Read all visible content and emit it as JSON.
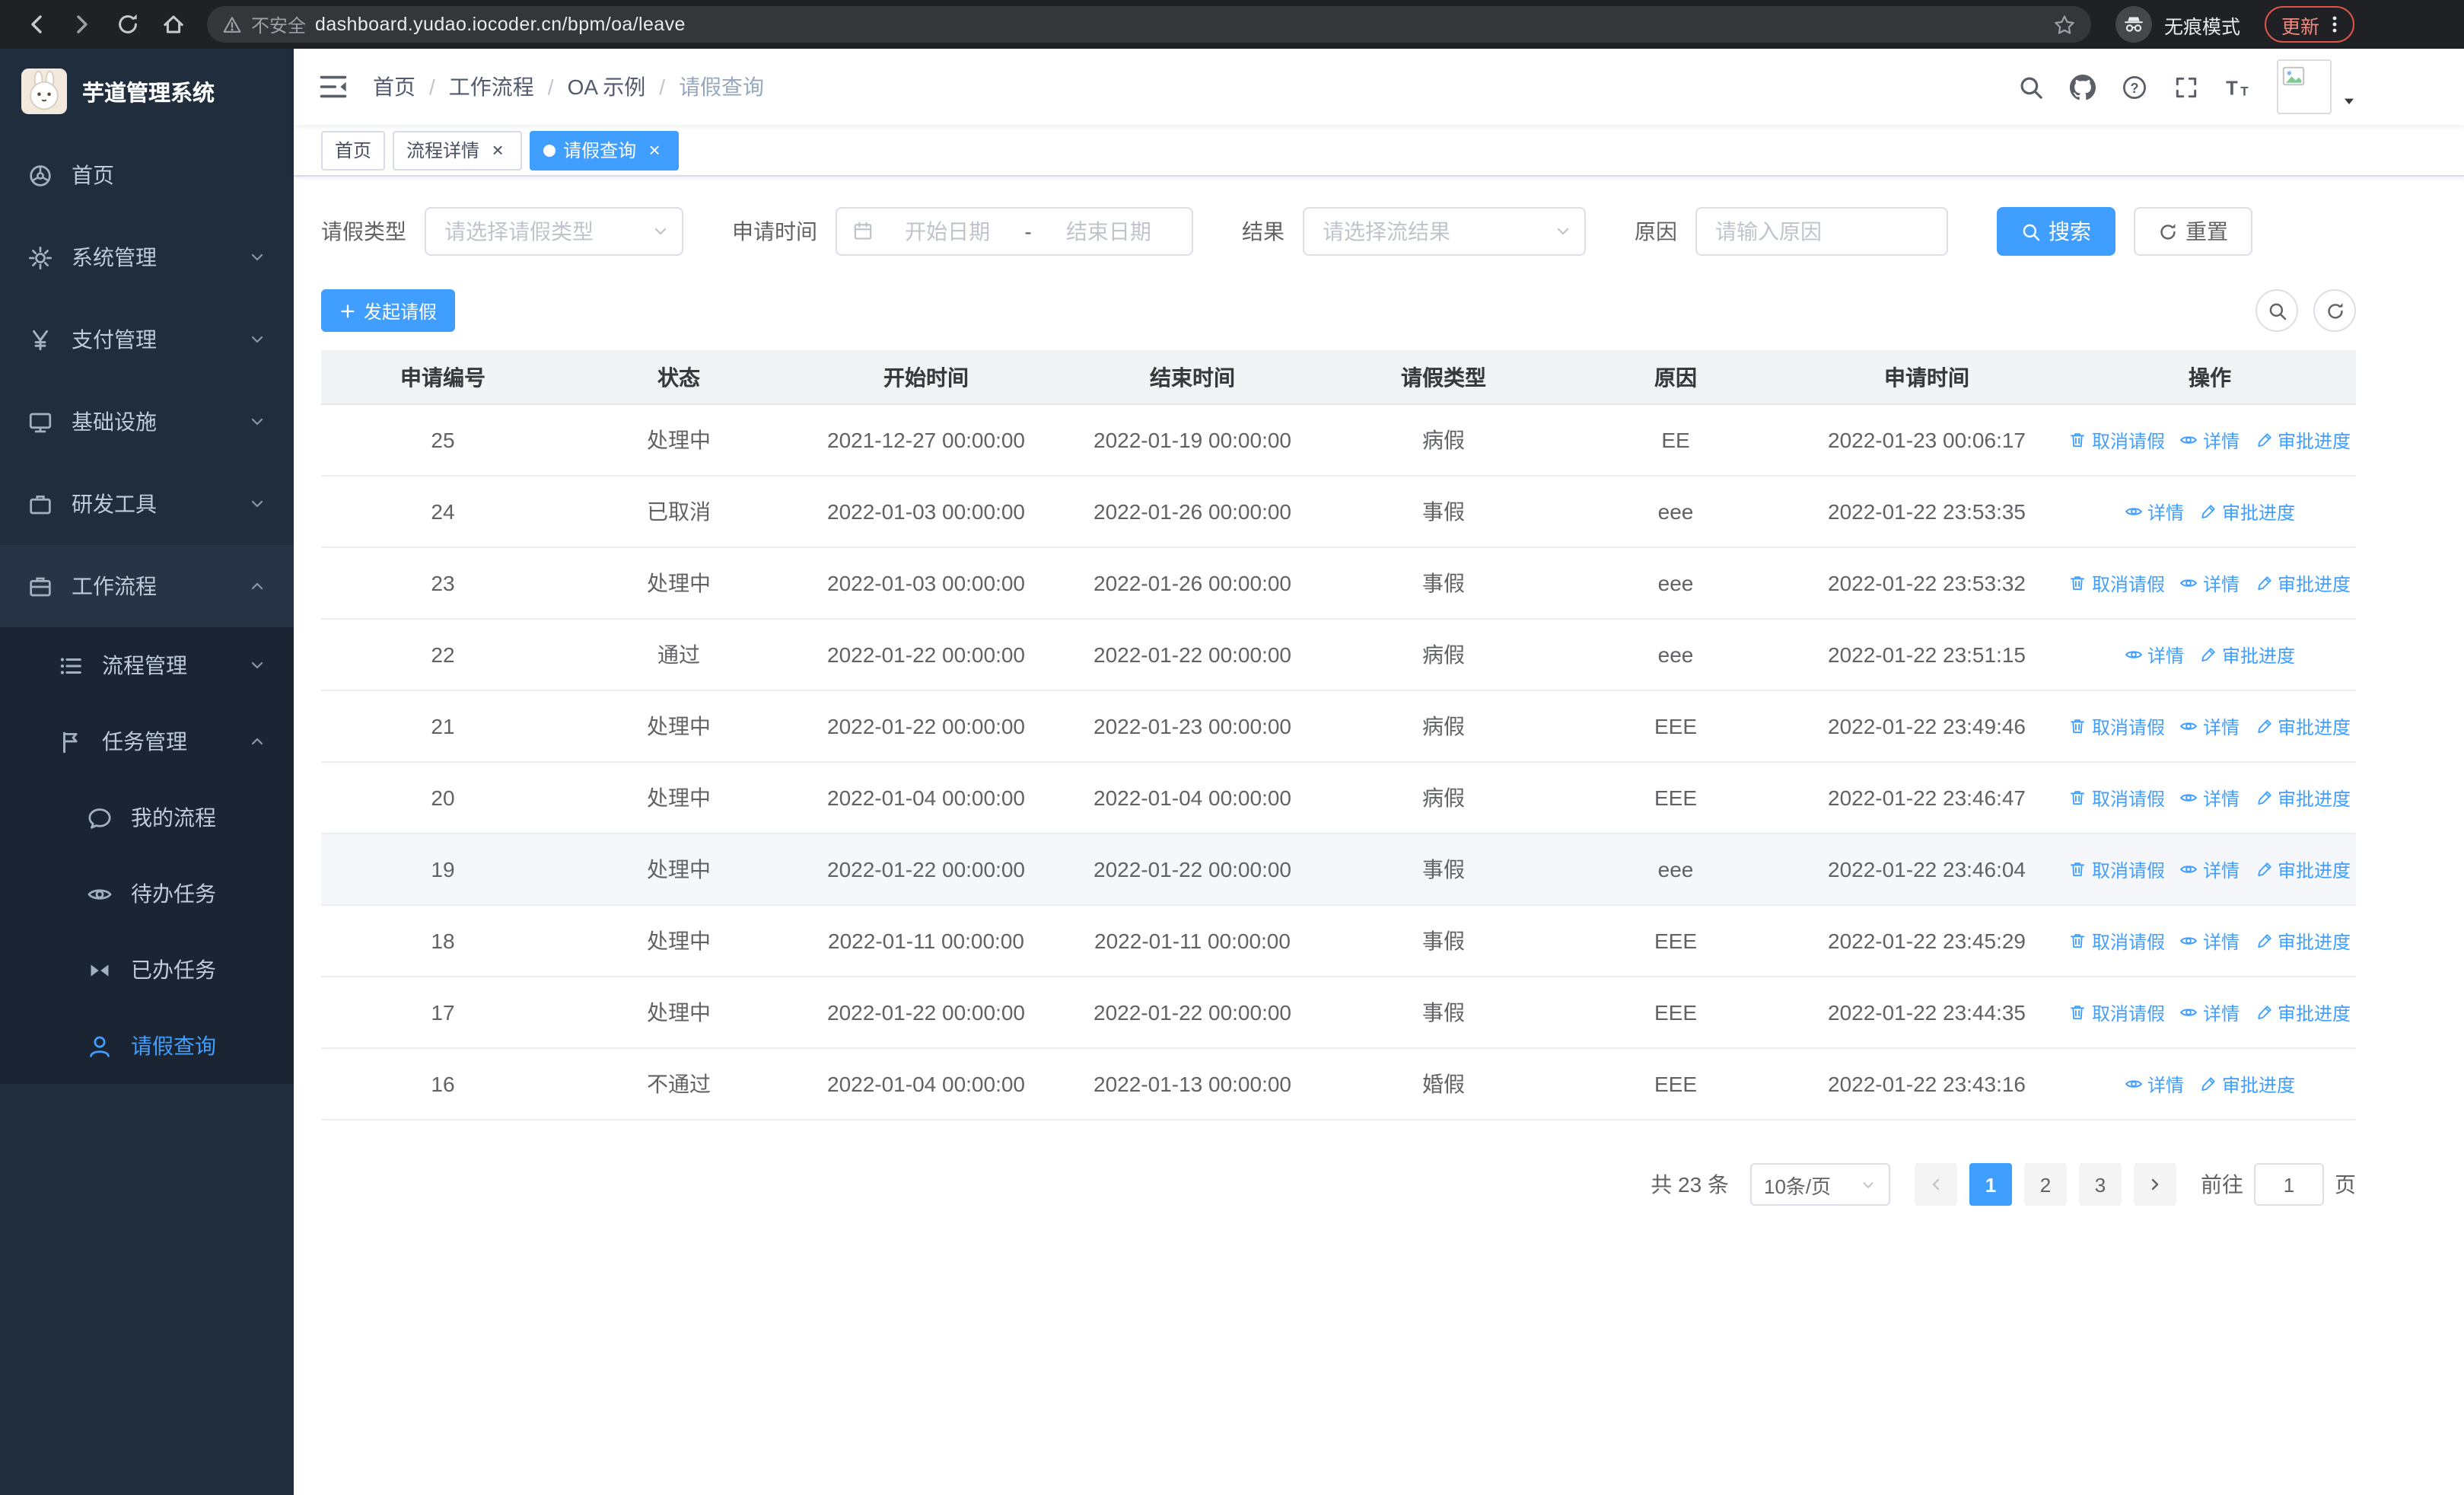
{
  "browser": {
    "security_label": "不安全",
    "url": "dashboard.yudao.iocoder.cn/bpm/oa/leave",
    "incognito_label": "无痕模式",
    "update_label": "更新"
  },
  "sidebar": {
    "app_title": "芋道管理系统",
    "items": {
      "home": "首页",
      "system": "系统管理",
      "payment": "支付管理",
      "infra": "基础设施",
      "devtools": "研发工具",
      "workflow": "工作流程",
      "process": "流程管理",
      "task": "任务管理",
      "my_process": "我的流程",
      "todo": "待办任务",
      "done": "已办任务",
      "leave_query": "请假查询"
    }
  },
  "breadcrumb": {
    "items": [
      "首页",
      "工作流程",
      "OA 示例",
      "请假查询"
    ],
    "separator": "/"
  },
  "tabs": {
    "t0": "首页",
    "t1": "流程详情",
    "t2": "请假查询"
  },
  "filter": {
    "leave_type_label": "请假类型",
    "leave_type_placeholder": "请选择请假类型",
    "apply_time_label": "申请时间",
    "start_placeholder": "开始日期",
    "range_separator": "-",
    "end_placeholder": "结束日期",
    "result_label": "结果",
    "result_placeholder": "请选择流结果",
    "reason_label": "原因",
    "reason_placeholder": "请输入原因",
    "search_label": "搜索",
    "reset_label": "重置"
  },
  "toolbar": {
    "create_label": "发起请假"
  },
  "table": {
    "columns": [
      "申请编号",
      "状态",
      "开始时间",
      "结束时间",
      "请假类型",
      "原因",
      "申请时间",
      "操作"
    ],
    "action_cancel": "取消请假",
    "action_detail": "详情",
    "action_progress": "审批进度",
    "rows": [
      {
        "id": "25",
        "status": "处理中",
        "start": "2021-12-27 00:00:00",
        "end": "2022-01-19 00:00:00",
        "type": "病假",
        "reason": "EE",
        "applied": "2022-01-23 00:06:17"
      },
      {
        "id": "24",
        "status": "已取消",
        "start": "2022-01-03 00:00:00",
        "end": "2022-01-26 00:00:00",
        "type": "事假",
        "reason": "eee",
        "applied": "2022-01-22 23:53:35"
      },
      {
        "id": "23",
        "status": "处理中",
        "start": "2022-01-03 00:00:00",
        "end": "2022-01-26 00:00:00",
        "type": "事假",
        "reason": "eee",
        "applied": "2022-01-22 23:53:32"
      },
      {
        "id": "22",
        "status": "通过",
        "start": "2022-01-22 00:00:00",
        "end": "2022-01-22 00:00:00",
        "type": "病假",
        "reason": "eee",
        "applied": "2022-01-22 23:51:15"
      },
      {
        "id": "21",
        "status": "处理中",
        "start": "2022-01-22 00:00:00",
        "end": "2022-01-23 00:00:00",
        "type": "病假",
        "reason": "EEE",
        "applied": "2022-01-22 23:49:46"
      },
      {
        "id": "20",
        "status": "处理中",
        "start": "2022-01-04 00:00:00",
        "end": "2022-01-04 00:00:00",
        "type": "病假",
        "reason": "EEE",
        "applied": "2022-01-22 23:46:47"
      },
      {
        "id": "19",
        "status": "处理中",
        "start": "2022-01-22 00:00:00",
        "end": "2022-01-22 00:00:00",
        "type": "事假",
        "reason": "eee",
        "applied": "2022-01-22 23:46:04"
      },
      {
        "id": "18",
        "status": "处理中",
        "start": "2022-01-11 00:00:00",
        "end": "2022-01-11 00:00:00",
        "type": "事假",
        "reason": "EEE",
        "applied": "2022-01-22 23:45:29"
      },
      {
        "id": "17",
        "status": "处理中",
        "start": "2022-01-22 00:00:00",
        "end": "2022-01-22 00:00:00",
        "type": "事假",
        "reason": "EEE",
        "applied": "2022-01-22 23:44:35"
      },
      {
        "id": "16",
        "status": "不通过",
        "start": "2022-01-04 00:00:00",
        "end": "2022-01-13 00:00:00",
        "type": "婚假",
        "reason": "EEE",
        "applied": "2022-01-22 23:43:16"
      }
    ]
  },
  "pagination": {
    "total_text": "共 23 条",
    "page_size": "10条/页",
    "pages": [
      "1",
      "2",
      "3"
    ],
    "goto_label": "前往",
    "goto_value": "1",
    "goto_suffix": "页"
  },
  "colors": {
    "primary": "#409eff",
    "sidebar_bg": "#1f2d3d",
    "link": "#409eff"
  }
}
